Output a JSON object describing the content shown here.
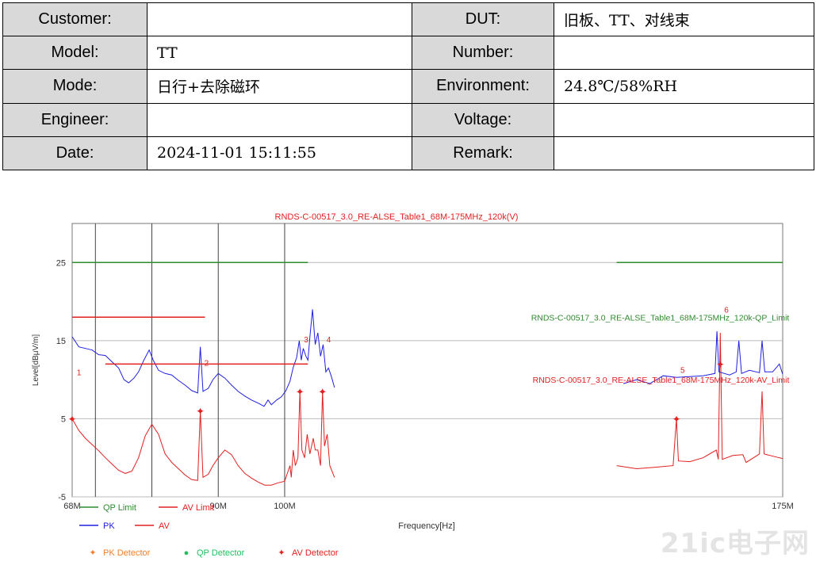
{
  "info_table": {
    "customer": {
      "label": "Customer:",
      "value": ""
    },
    "dut": {
      "label": "DUT:",
      "value": "旧板、TT、对线束"
    },
    "model": {
      "label": "Model:",
      "value": "TT"
    },
    "number": {
      "label": "Number:",
      "value": ""
    },
    "mode": {
      "label": "Mode:",
      "value": "日行+去除磁环"
    },
    "environment": {
      "label": "Environment:",
      "value": "24.8℃/58%RH"
    },
    "engineer": {
      "label": "Engineer:",
      "value": ""
    },
    "voltage": {
      "label": "Voltage:",
      "value": ""
    },
    "date": {
      "label": "Date:",
      "value": "2024-11-01 15:11:55"
    },
    "remark": {
      "label": "Remark:",
      "value": ""
    }
  },
  "chart_data": {
    "type": "line",
    "title": "RNDS-C-00517_3.0_RE-ALSE_Table1_68M-175MHz_120k(V)",
    "xlabel": "Frequency[Hz]",
    "ylabel": "Level[dBμV/m]",
    "xlim": [
      68,
      175
    ],
    "ylim": [
      -5,
      30
    ],
    "x_tick_labels": [
      {
        "x": 68,
        "label": "68M"
      },
      {
        "x": 90,
        "label": "90M"
      },
      {
        "x": 100,
        "label": "100M"
      },
      {
        "x": 175,
        "label": "175M"
      }
    ],
    "x_grid": [
      71.5,
      80,
      90,
      100
    ],
    "y_ticks": [
      25,
      15,
      5,
      -5
    ],
    "grid": true,
    "limit_lines": [
      {
        "name": "QP Limit",
        "color": "#2e8b2e",
        "segments": [
          [
            68,
            103.5,
            25
          ],
          [
            150,
            175,
            25
          ]
        ],
        "annotation": "RNDS-C-00517_3.0_RE-ALSE_Table1_68M-175MHz_120k-QP_Limit",
        "annotation_at": [
          176,
          18
        ]
      },
      {
        "name": "AV Limit",
        "color": "#e02020",
        "segments": [
          [
            68,
            88,
            18
          ],
          [
            73,
            103.5,
            12
          ]
        ],
        "annotation": "RNDS-C-00517_3.0_RE-ALSE_Table1_68M-175MHz_120k-AV_Limit",
        "annotation_at": [
          176,
          10
        ]
      }
    ],
    "series": [
      {
        "name": "PK",
        "color": "#2020e0",
        "ranges": [
          [
            68,
            103.5
          ],
          [
            150,
            175
          ]
        ],
        "points": [
          [
            68,
            15.5
          ],
          [
            69,
            14.2
          ],
          [
            70,
            14
          ],
          [
            71,
            13.8
          ],
          [
            72,
            13.2
          ],
          [
            73,
            13.1
          ],
          [
            74,
            12.3
          ],
          [
            75,
            11.5
          ],
          [
            75.8,
            10
          ],
          [
            76.5,
            9.6
          ],
          [
            77.3,
            10.2
          ],
          [
            78,
            11
          ],
          [
            78.8,
            12.5
          ],
          [
            79.6,
            13.8
          ],
          [
            80.2,
            12.5
          ],
          [
            81,
            11.2
          ],
          [
            82,
            10.8
          ],
          [
            83,
            10.6
          ],
          [
            84,
            9.9
          ],
          [
            85,
            9.3
          ],
          [
            86,
            8.6
          ],
          [
            86.9,
            8.3
          ],
          [
            87.3,
            14.2
          ],
          [
            87.7,
            8.5
          ],
          [
            88.5,
            8.9
          ],
          [
            89.2,
            10
          ],
          [
            90,
            10.8
          ],
          [
            91,
            10.2
          ],
          [
            92,
            9.3
          ],
          [
            93,
            8.5
          ],
          [
            94,
            7.9
          ],
          [
            95,
            7.4
          ],
          [
            96,
            7
          ],
          [
            96.9,
            6.6
          ],
          [
            97.5,
            7.4
          ],
          [
            98,
            6.8
          ],
          [
            98.8,
            7.4
          ],
          [
            99.5,
            7.8
          ],
          [
            100.2,
            8.6
          ],
          [
            100.8,
            9.8
          ],
          [
            101.3,
            11.6
          ],
          [
            101.8,
            12.8
          ],
          [
            102.2,
            15
          ],
          [
            102.5,
            12.5
          ],
          [
            102.8,
            14
          ],
          [
            103.2,
            13
          ],
          [
            103.5,
            12.5
          ],
          [
            103.8,
            15.5
          ],
          [
            104.2,
            19
          ],
          [
            104.6,
            14.5
          ],
          [
            105,
            16
          ],
          [
            105.4,
            13
          ],
          [
            105.8,
            14.5
          ],
          [
            106.2,
            11
          ],
          [
            106.6,
            11.5
          ],
          [
            107,
            10.5
          ],
          [
            107.5,
            9
          ],
          [
            151,
            9.5
          ],
          [
            153,
            10
          ],
          [
            155,
            9.5
          ],
          [
            157,
            10.5
          ],
          [
            159,
            10.3
          ],
          [
            161,
            10.4
          ],
          [
            163,
            10.5
          ],
          [
            164.8,
            10.8
          ],
          [
            165.1,
            16.2
          ],
          [
            165.4,
            11
          ],
          [
            167,
            10.6
          ],
          [
            168,
            11
          ],
          [
            168.4,
            15
          ],
          [
            168.8,
            10.8
          ],
          [
            170,
            11.2
          ],
          [
            171.5,
            10.9
          ],
          [
            171.9,
            15
          ],
          [
            172.3,
            11
          ],
          [
            173.5,
            11
          ],
          [
            174.5,
            12
          ],
          [
            175,
            10.7
          ]
        ]
      },
      {
        "name": "AV",
        "color": "#e02020",
        "ranges": [
          [
            68,
            107.5
          ],
          [
            150,
            175
          ]
        ],
        "points": [
          [
            68,
            5
          ],
          [
            69,
            3.5
          ],
          [
            70,
            2.5
          ],
          [
            71,
            1.7
          ],
          [
            72,
            0.9
          ],
          [
            73,
            0
          ],
          [
            74,
            -0.8
          ],
          [
            75,
            -1.6
          ],
          [
            76,
            -2
          ],
          [
            77,
            -1.7
          ],
          [
            78,
            0
          ],
          [
            79,
            2.8
          ],
          [
            80,
            4.3
          ],
          [
            81,
            3
          ],
          [
            82,
            0.5
          ],
          [
            83,
            -0.6
          ],
          [
            84,
            -1.4
          ],
          [
            85,
            -2.2
          ],
          [
            86,
            -2.8
          ],
          [
            86.9,
            -2.9
          ],
          [
            87.3,
            6
          ],
          [
            87.7,
            -2.5
          ],
          [
            88.5,
            -2.1
          ],
          [
            89.2,
            -1
          ],
          [
            90,
            0
          ],
          [
            91,
            1
          ],
          [
            92,
            0.4
          ],
          [
            93,
            -1
          ],
          [
            94,
            -2
          ],
          [
            95,
            -2.6
          ],
          [
            96,
            -3.1
          ],
          [
            97,
            -3.5
          ],
          [
            98,
            -3.5
          ],
          [
            99,
            -3.2
          ],
          [
            100,
            -3
          ],
          [
            100.4,
            -2
          ],
          [
            100.8,
            -1
          ],
          [
            101,
            -2.5
          ],
          [
            101.3,
            1
          ],
          [
            101.6,
            -1
          ],
          [
            102,
            0
          ],
          [
            102.3,
            8.5
          ],
          [
            102.6,
            1
          ],
          [
            103,
            0
          ],
          [
            103.4,
            3
          ],
          [
            103.8,
            0.5
          ],
          [
            104.3,
            2.5
          ],
          [
            104.6,
            1
          ],
          [
            105,
            1
          ],
          [
            105.4,
            -1
          ],
          [
            105.7,
            8.5
          ],
          [
            106,
            1.5
          ],
          [
            106.4,
            3
          ],
          [
            106.8,
            -1
          ],
          [
            107.5,
            -2.5
          ],
          [
            150,
            -1
          ],
          [
            153,
            -1.4
          ],
          [
            156,
            -1.2
          ],
          [
            158.5,
            -1
          ],
          [
            159,
            5
          ],
          [
            159.3,
            -0.4
          ],
          [
            161,
            -0.5
          ],
          [
            163,
            0
          ],
          [
            165,
            1
          ],
          [
            165.3,
            -0.2
          ],
          [
            165.6,
            16
          ],
          [
            165.9,
            -0.2
          ],
          [
            167.5,
            0.3
          ],
          [
            169,
            0.4
          ],
          [
            169.5,
            -0.6
          ],
          [
            171.5,
            0.5
          ],
          [
            171.9,
            8.5
          ],
          [
            172.2,
            0.5
          ],
          [
            174,
            0.1
          ],
          [
            175,
            -0.1
          ]
        ]
      }
    ],
    "markers": [
      {
        "id": "1",
        "x": 68.1,
        "y": 11
      },
      {
        "id": "2",
        "x": 87.3,
        "y": 12.2
      },
      {
        "id": "3",
        "x": 102.3,
        "y": 15.2
      },
      {
        "id": "4",
        "x": 105.7,
        "y": 15.2
      },
      {
        "id": "5",
        "x": 159,
        "y": 11.3
      },
      {
        "id": "6",
        "x": 165.6,
        "y": 19
      }
    ],
    "av_detector_points": [
      [
        68,
        5
      ],
      [
        87.3,
        6
      ],
      [
        102.3,
        8.5
      ],
      [
        105.7,
        8.5
      ],
      [
        159,
        5
      ],
      [
        165.6,
        12
      ]
    ],
    "legend": {
      "placement": "bottom",
      "lines": [
        {
          "label": "QP Limit",
          "color": "#2e8b2e"
        },
        {
          "label": "AV Limit",
          "color": "#e02020"
        },
        {
          "label": "PK",
          "color": "#2020e0"
        },
        {
          "label": "AV",
          "color": "#e02020"
        }
      ],
      "detectors": [
        {
          "label": "PK Detector",
          "color": "#f08030",
          "symbol": "✦"
        },
        {
          "label": "QP Detector",
          "color": "#20c060",
          "symbol": "●"
        },
        {
          "label": "AV Detector",
          "color": "#e02020",
          "symbol": "✦"
        }
      ]
    }
  },
  "watermark": {
    "text": "21ic电子网"
  }
}
